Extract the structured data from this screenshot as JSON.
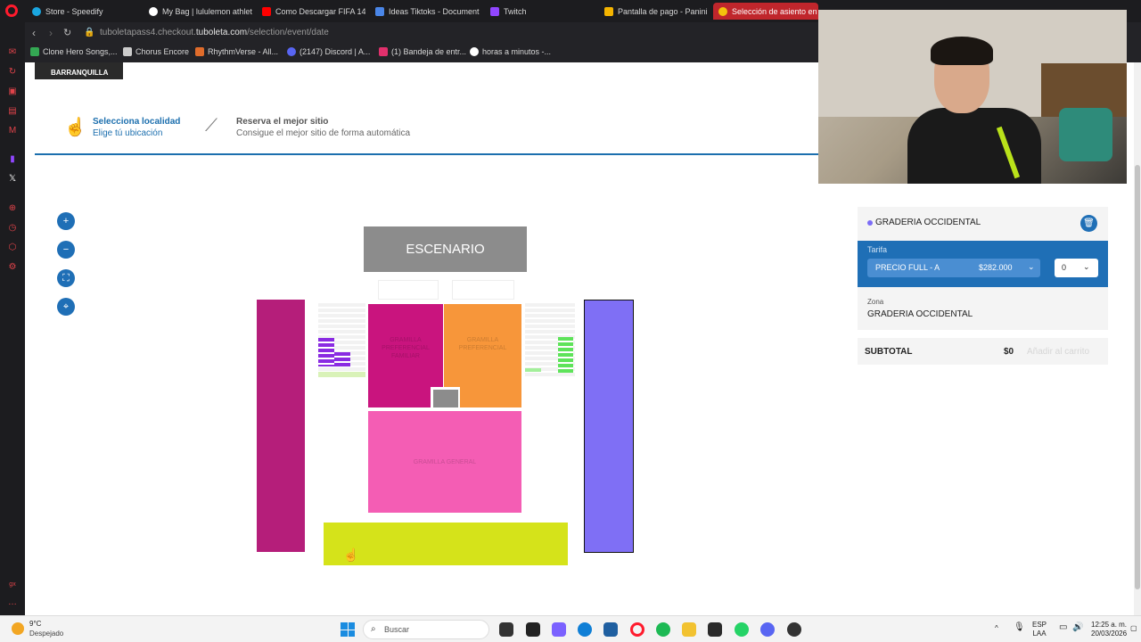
{
  "browser": {
    "tabs": [
      {
        "label": "Store - Speedify",
        "color": "#1aa6e0"
      },
      {
        "label": "My Bag | lululemon athleti",
        "color": "#ffffff"
      },
      {
        "label": "Como Descargar FIFA 14 I",
        "color": "#ff0000"
      },
      {
        "label": "Ideas Tiktoks - Document",
        "color": "#4a86e8"
      },
      {
        "label": "Twitch",
        "color": "#9146ff"
      },
      {
        "label": "Pantalla de pago - Panini",
        "color": "#f4b400"
      },
      {
        "label": "Selección de asiento en e",
        "color": "#f4c20d",
        "active": true
      }
    ],
    "url_prefix": "tuboletapass4.checkout.",
    "url_host": "tuboleta.com",
    "url_path": "/selection/event/date",
    "bookmarks": [
      {
        "label": "Clone Hero Songs,...",
        "color": "#34a853"
      },
      {
        "label": "Chorus Encore",
        "color": "#cccccc"
      },
      {
        "label": "RhythmVerse - All...",
        "color": "#e06c2b"
      },
      {
        "label": "(2147) Discord | A...",
        "color": "#5865f2"
      },
      {
        "label": "(1) Bandeja de entr...",
        "color": "#e1306c"
      },
      {
        "label": "horas a minutos -...",
        "color": "#ffffff"
      }
    ]
  },
  "page": {
    "banner_text": "BARRANQUILLA",
    "steps": [
      {
        "title": "Selecciona localidad",
        "subtitle": "Elige tú ubicación",
        "icon": "hand-pointer-icon"
      },
      {
        "title": "Reserva el mejor sitio",
        "subtitle": "Consigue el mejor sitio de forma automática",
        "icon": "magic-wand-icon"
      }
    ],
    "zoom_controls": [
      "zoom-in-icon",
      "zoom-out-icon",
      "fit-screen-icon",
      "location-icon"
    ],
    "map": {
      "stage_label": "ESCENARIO",
      "zones": [
        {
          "label": "GRAMILLA PREFERENCIAL FAMILIAR",
          "color": "#c9147e"
        },
        {
          "label": "GRAMILLA PREFERENCIAL",
          "color": "#f7963a"
        },
        {
          "label": "GRAMILLA GENERAL",
          "color": "#f45db4"
        }
      ],
      "colors": {
        "left_stand": "#b51e7a",
        "right_stand": "#7f6ff5",
        "bottom_stand": "#d5e31a",
        "box": "#8c8c8c",
        "stage": "#8c8c8c"
      }
    }
  },
  "panel": {
    "zone_title": "GRADERIA OCCIDENTAL",
    "tarifa_label": "Tarifa",
    "tarifa_name": "PRECIO FULL - A",
    "tarifa_price": "$282.000",
    "quantity": "0",
    "zona_label": "Zona",
    "zona_value": "GRADERIA OCCIDENTAL",
    "subtotal_label": "SUBTOTAL",
    "subtotal_value": "$0",
    "add_to_cart": "Añadir al carrito"
  },
  "taskbar": {
    "temperature": "9°C",
    "weather": "Despejado",
    "search_placeholder": "Buscar",
    "language": "ESP",
    "language_sub": "LAA",
    "time": "12:25 a. m.",
    "date": "20/03/2026"
  }
}
